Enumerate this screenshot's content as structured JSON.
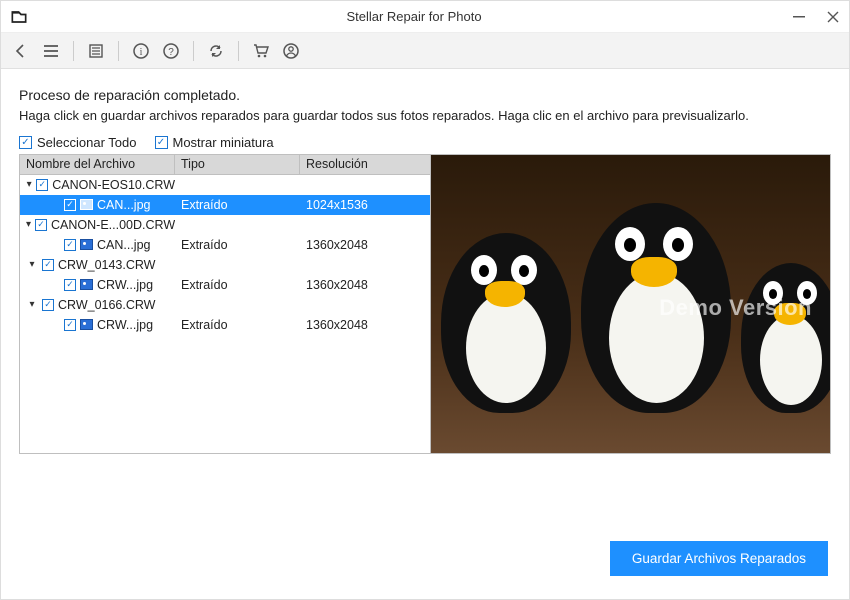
{
  "window": {
    "title": "Stellar Repair for Photo"
  },
  "toolbar": {
    "icons": [
      "back",
      "menu",
      "list",
      "info",
      "help",
      "refresh",
      "cart",
      "user"
    ]
  },
  "main": {
    "heading": "Proceso de reparación completado.",
    "subtext": "Haga click en guardar archivos reparados para guardar todos sus fotos reparados. Haga clic en el archivo para previsualizarlo.",
    "select_all_label": "Seleccionar Todo",
    "show_thumb_label": "Mostrar miniatura"
  },
  "columns": {
    "name": "Nombre del Archivo",
    "type": "Tipo",
    "resolution": "Resolución"
  },
  "tree": [
    {
      "name": "CANON-EOS10.CRW",
      "children": [
        {
          "name": "CAN...jpg",
          "type": "Extraído",
          "resolution": "1024x1536",
          "selected": true
        }
      ]
    },
    {
      "name": "CANON-E...00D.CRW",
      "children": [
        {
          "name": "CAN...jpg",
          "type": "Extraído",
          "resolution": "1360x2048",
          "selected": false
        }
      ]
    },
    {
      "name": "CRW_0143.CRW",
      "children": [
        {
          "name": "CRW...jpg",
          "type": "Extraído",
          "resolution": "1360x2048",
          "selected": false
        }
      ]
    },
    {
      "name": "CRW_0166.CRW",
      "children": [
        {
          "name": "CRW...jpg",
          "type": "Extraído",
          "resolution": "1360x2048",
          "selected": false
        }
      ]
    }
  ],
  "preview": {
    "watermark": "Demo Version"
  },
  "footer": {
    "save_button": "Guardar Archivos Reparados"
  }
}
